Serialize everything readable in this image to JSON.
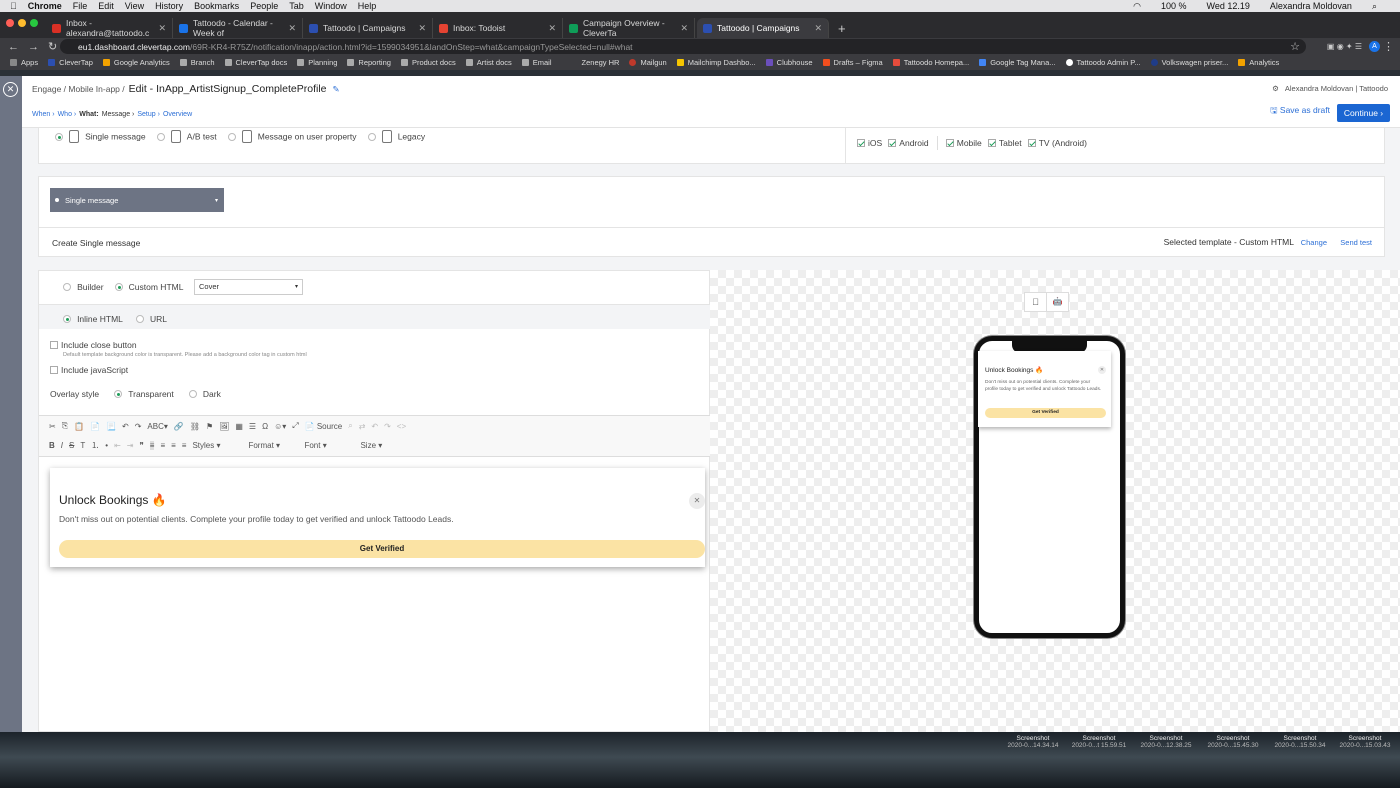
{
  "menubar": {
    "app": "Chrome",
    "items": [
      "File",
      "Edit",
      "View",
      "History",
      "Bookmarks",
      "People",
      "Tab",
      "Window",
      "Help"
    ],
    "battery": "100 %",
    "clock": "Wed 12.19",
    "user": "Alexandra Moldovan"
  },
  "tabs": [
    {
      "label": "Inbox - alexandra@tattoodo.c",
      "color": "#d93025"
    },
    {
      "label": "Tattoodo - Calendar - Week of",
      "color": "#1a73e8"
    },
    {
      "label": "Tattoodo | Campaigns",
      "color": "#2c4fb0"
    },
    {
      "label": "Inbox: Todoist",
      "color": "#e44332"
    },
    {
      "label": "Campaign Overview - CleverTa",
      "color": "#0f9d58"
    },
    {
      "label": "Tattoodo | Campaigns",
      "color": "#2c4fb0"
    }
  ],
  "address": {
    "host": "eu1.dashboard.clevertap.com",
    "path": "/69R-KR4-R75Z/notification/inapp/action.html?id=1599034951&landOnStep=what&campaignTypeSelected=null#what"
  },
  "bookmarks": [
    "Apps",
    "CleverTap",
    "Google Analytics",
    "Branch",
    "CleverTap docs",
    "Planning",
    "Reporting",
    "Product docs",
    "Artist docs",
    "Email",
    "Zenegy HR",
    "Mailgun",
    "Mailchimp Dashbo...",
    "Clubhouse",
    "Drafts – Figma",
    "Tattoodo Homepa...",
    "Google Tag Mana...",
    "Tattoodo Admin P...",
    "Volkswagen priser...",
    "Analytics"
  ],
  "header": {
    "crumb1": "Engage /",
    "crumb2": "Mobile In-app /",
    "title": "Edit - InApp_ArtistSignup_CompleteProfile",
    "user": "Alexandra Moldovan | Tattoodo",
    "steps": {
      "when": "When ›",
      "who": "Who ›",
      "what": "What:",
      "message": "Message ›",
      "setup": "Setup ›",
      "overview": "Overview"
    },
    "save_draft": "Save as draft",
    "continue": "Continue ›"
  },
  "message_types": {
    "single": "Single message",
    "ab": "A/B test",
    "user_prop": "Message on user property",
    "legacy": "Legacy"
  },
  "platforms": {
    "ios": "iOS",
    "android": "Android",
    "mobile": "Mobile",
    "tablet": "Tablet",
    "tv": "TV (Android)"
  },
  "variant_select": "Single message",
  "create_bar": {
    "label": "Create Single message",
    "template": "Selected template - Custom HTML",
    "change": "Change",
    "send_test": "Send test"
  },
  "editor": {
    "builder": "Builder",
    "custom_html": "Custom HTML",
    "layout": "Cover",
    "inline_html": "Inline HTML",
    "url": "URL",
    "close_button": "Include close button",
    "close_hint": "Default template background color is transparent. Please add a background color tag in custom html",
    "javascript": "Include javaScript",
    "overlay_label": "Overlay style",
    "transparent": "Transparent",
    "dark": "Dark",
    "toolbar": {
      "source": "Source",
      "styles": "Styles",
      "format": "Format",
      "font": "Font",
      "size": "Size"
    }
  },
  "message": {
    "title": "Unlock Bookings 🔥",
    "body": "Don't miss out on potential clients. Complete your profile today to get verified and unlock Tattoodo Leads.",
    "button": "Get Verified",
    "button_color": "#fbe3a4"
  },
  "preview_message": {
    "title": "Unlock Bookings 🔥",
    "body": "Don't miss out on potential clients. Complete your profile today to get verified and unlock Tattoodo Leads.",
    "button": "Get Verified"
  },
  "desktop": {
    "screenshots": [
      {
        "name": "Screenshot",
        "date": "2020-0...14.34.14"
      },
      {
        "name": "Screenshot",
        "date": "2020-0...t 15.59.51"
      },
      {
        "name": "Screenshot",
        "date": "2020-0...12.38.25"
      },
      {
        "name": "Screenshot",
        "date": "2020-0...15.45.30"
      },
      {
        "name": "Screenshot",
        "date": "2020-0...15.50.34"
      },
      {
        "name": "Screenshot",
        "date": "2020-0...15.03.43"
      }
    ]
  }
}
